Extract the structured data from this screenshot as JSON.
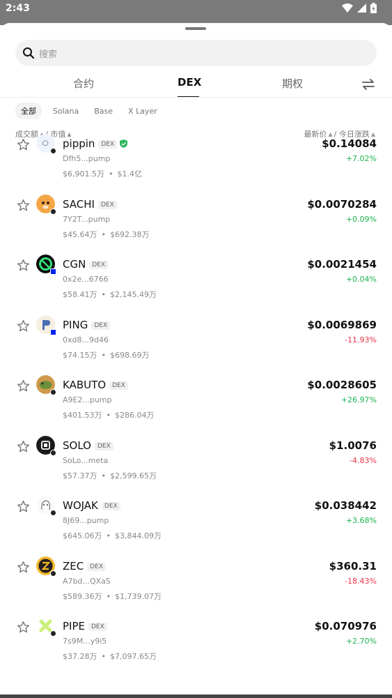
{
  "status": {
    "time": "2:43"
  },
  "search": {
    "placeholder": "搜索"
  },
  "tabs": [
    {
      "label": "合约"
    },
    {
      "label": "DEX"
    },
    {
      "label": "期权"
    }
  ],
  "chains": [
    {
      "label": "全部"
    },
    {
      "label": "Solana"
    },
    {
      "label": "Base"
    },
    {
      "label": "X Layer"
    }
  ],
  "sort": {
    "left_a": "成交额",
    "left_sep": "/",
    "left_b": "市值",
    "right_a": "最新价",
    "right_sep": "/",
    "right_b": "今日涨跌"
  },
  "tokens": [
    {
      "name": "pippin",
      "tag": "DEX",
      "addr": "Dfh5...pump",
      "volume": "$6,901.5万",
      "mcap": "$1.4亿",
      "price": "$0.14084",
      "change": "+7.02%",
      "verified": true
    },
    {
      "name": "SACHI",
      "tag": "DEX",
      "addr": "7Y2T...pump",
      "volume": "$45.64万",
      "mcap": "$692.38万",
      "price": "$0.0070284",
      "change": "+0.09%"
    },
    {
      "name": "CGN",
      "tag": "DEX",
      "addr": "0x2e...6766",
      "volume": "$58.41万",
      "mcap": "$2,145.49万",
      "price": "$0.0021454",
      "change": "+0.04%"
    },
    {
      "name": "PING",
      "tag": "DEX",
      "addr": "0xd8...9d46",
      "volume": "$74.15万",
      "mcap": "$698.69万",
      "price": "$0.0069869",
      "change": "-11.93%"
    },
    {
      "name": "KABUTO",
      "tag": "DEX",
      "addr": "A9E2...pump",
      "volume": "$401.53万",
      "mcap": "$286.04万",
      "price": "$0.0028605",
      "change": "+26.97%"
    },
    {
      "name": "SOLO",
      "tag": "DEX",
      "addr": "SoLo...meta",
      "volume": "$57.37万",
      "mcap": "$2,599.65万",
      "price": "$1.0076",
      "change": "-4.83%"
    },
    {
      "name": "WOJAK",
      "tag": "DEX",
      "addr": "8J69...pump",
      "volume": "$645.06万",
      "mcap": "$3,844.09万",
      "price": "$0.038442",
      "change": "+3.68%"
    },
    {
      "name": "ZEC",
      "tag": "DEX",
      "addr": "A7bd...QXaS",
      "volume": "$589.36万",
      "mcap": "$1,739.07万",
      "price": "$360.31",
      "change": "-18.43%"
    },
    {
      "name": "PIPE",
      "tag": "DEX",
      "addr": "7s9M...y9i5",
      "volume": "$37.28万",
      "mcap": "$7,097.65万",
      "price": "$0.070976",
      "change": "+2.70%"
    }
  ],
  "colors": {
    "up": "#1cb34e",
    "down": "#e8334a",
    "verified": "#2bb55a"
  }
}
